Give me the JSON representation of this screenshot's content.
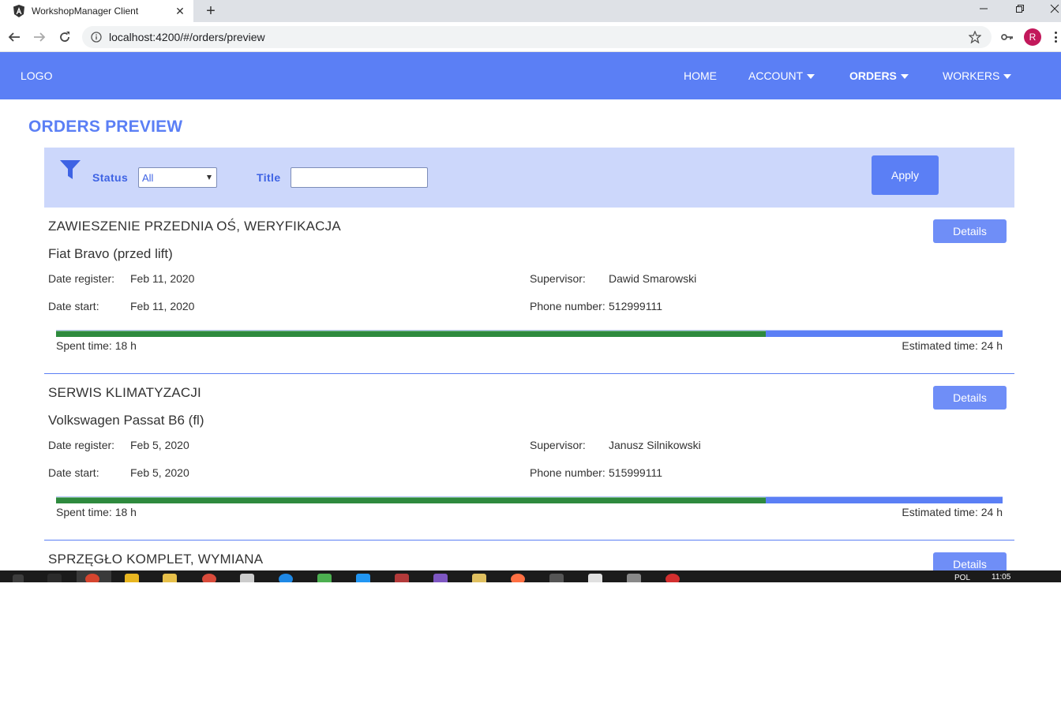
{
  "browser": {
    "tab_title": "WorkshopManager Client",
    "url": "localhost:4200/#/orders/preview",
    "avatar_initial": "R"
  },
  "navbar": {
    "logo": "LOGO",
    "items": [
      {
        "label": "HOME",
        "dropdown": false,
        "active": false
      },
      {
        "label": "ACCOUNT",
        "dropdown": true,
        "active": false
      },
      {
        "label": "ORDERS",
        "dropdown": true,
        "active": true
      },
      {
        "label": "WORKERS",
        "dropdown": true,
        "active": false
      }
    ]
  },
  "page": {
    "title": "ORDERS PREVIEW"
  },
  "filter": {
    "status_label": "Status",
    "status_value": "All",
    "title_label": "Title",
    "title_value": "",
    "apply_label": "Apply"
  },
  "labels": {
    "date_register": "Date register:",
    "date_start": "Date start:",
    "supervisor": "Supervisor:",
    "phone_number": "Phone number:",
    "details": "Details"
  },
  "orders": [
    {
      "title": "ZAWIESZENIE PRZEDNIA OŚ, WERYFIKACJA",
      "car": "Fiat Bravo (przed lift)",
      "date_register": "Feb 11, 2020",
      "date_start": "Feb 11, 2020",
      "supervisor": "Dawid Smarowski",
      "phone": "512999111",
      "spent_text": "Spent time: 18 h",
      "estimated_text": "Estimated time: 24 h",
      "progress": 0.75
    },
    {
      "title": "SERWIS KLIMATYZACJI",
      "car": "Volkswagen Passat B6 (fl)",
      "date_register": "Feb 5, 2020",
      "date_start": "Feb 5, 2020",
      "supervisor": "Janusz Silnikowski",
      "phone": "515999111",
      "spent_text": "Spent time: 18 h",
      "estimated_text": "Estimated time: 24 h",
      "progress": 0.75
    },
    {
      "title": "SPRZĘGŁO KOMPLET, WYMIANA"
    }
  ],
  "taskbar": {
    "time": "11:05",
    "lang": "POL"
  },
  "colors": {
    "primary": "#5b7ff5",
    "filter_bg": "#ccd7fb",
    "progress_done": "#2e8a3e"
  }
}
